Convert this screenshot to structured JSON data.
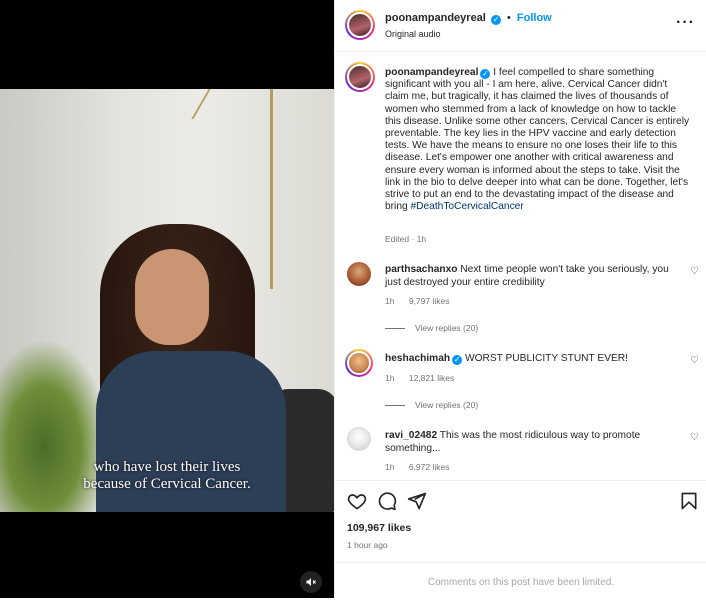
{
  "post": {
    "username": "poonampandeyreal",
    "follow_label": "Follow",
    "separator": "•",
    "audio": "Original audio"
  },
  "video": {
    "subtitle_line1": "who have lost their lives",
    "subtitle_line2": "because of Cervical Cancer."
  },
  "caption": {
    "username": "poonampandeyreal",
    "text": " I feel compelled to share something significant with you all - I am here, alive. Cervical Cancer didn't claim me, but tragically, it has claimed the lives of thousands of women who stemmed from a lack of knowledge on how to tackle this disease. Unlike some other cancers, Cervical Cancer is entirely preventable. The key lies in the HPV vaccine and early detection tests. We have the means to ensure no one loses their life to this disease. Let's empower one another with critical awareness and ensure every woman is informed about the steps to take. Visit the link in the bio to delve deeper into what can be done. Together, let's strive to put an end to the devastating impact of the disease and bring ",
    "hashtag": "#DeathToCervicalCancer",
    "meta": "Edited · 1h"
  },
  "comments": [
    {
      "username": "parthsachanxo",
      "text": " Next time people won't take you seriously, you just destroyed your entire credibility",
      "time": "1h",
      "likes": "9,797 likes",
      "replies": "View replies (20)"
    },
    {
      "username": "heshachimah",
      "text": " WORST PUBLICITY STUNT EVER!",
      "time": "1h",
      "likes": "12,821 likes",
      "replies": "View replies (20)"
    },
    {
      "username": "ravi_02482",
      "text": " This was the most ridiculous way to promote something...",
      "time": "1h",
      "likes": "6,972 likes"
    }
  ],
  "stats": {
    "likes": "109,967 likes",
    "time": "1 hour ago"
  },
  "footer": {
    "limited": "Comments on this post have been limited."
  },
  "icons": {
    "like": "heart-icon",
    "comment": "comment-icon",
    "share": "share-icon",
    "save": "bookmark-icon",
    "mute": "muted-speaker-icon",
    "more": "more-options-icon",
    "verified": "verified-badge-icon"
  },
  "colors": {
    "accent": "#0095f6",
    "hashtag": "#00376b",
    "muted_text": "#737373"
  }
}
